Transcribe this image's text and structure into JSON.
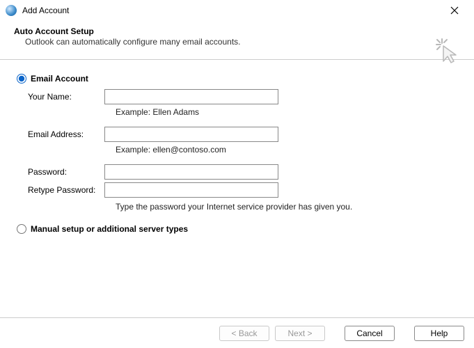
{
  "titlebar": {
    "title": "Add Account"
  },
  "header": {
    "heading": "Auto Account Setup",
    "subheading": "Outlook can automatically configure many email accounts."
  },
  "options": {
    "email_account_label": "Email Account",
    "manual_setup_label": "Manual setup or additional server types",
    "selected": "email_account"
  },
  "form": {
    "name_label": "Your Name:",
    "name_value": "",
    "name_hint": "Example: Ellen Adams",
    "email_label": "Email Address:",
    "email_value": "",
    "email_hint": "Example: ellen@contoso.com",
    "password_label": "Password:",
    "password_value": "",
    "retype_label": "Retype Password:",
    "retype_value": "",
    "password_hint": "Type the password your Internet service provider has given you."
  },
  "footer": {
    "back_label": "< Back",
    "next_label": "Next >",
    "cancel_label": "Cancel",
    "help_label": "Help"
  }
}
